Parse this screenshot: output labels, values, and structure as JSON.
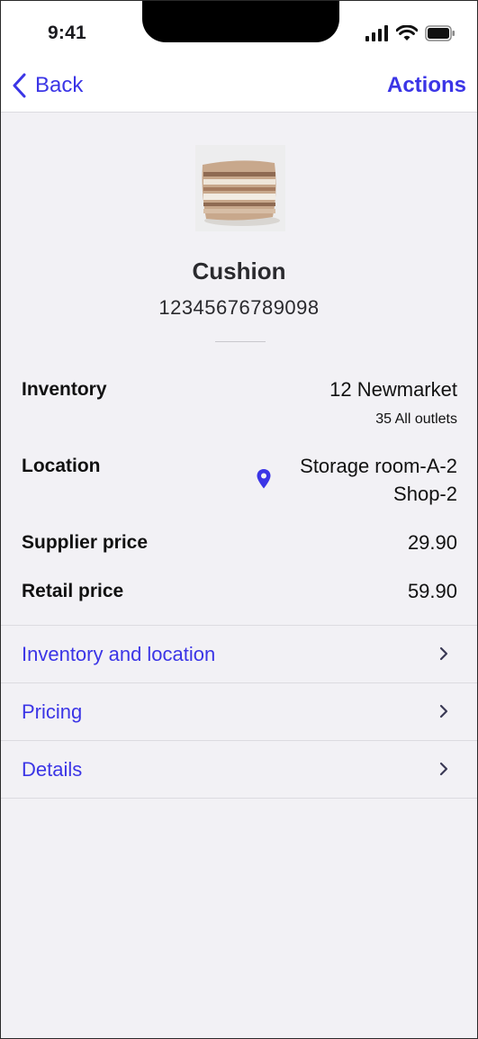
{
  "status_bar": {
    "time": "9:41"
  },
  "nav": {
    "back_label": "Back",
    "actions_label": "Actions"
  },
  "product": {
    "name": "Cushion",
    "code": "12345676789098"
  },
  "info": {
    "inventory_label": "Inventory",
    "inventory_value": "12 Newmarket",
    "inventory_sub": "35 All outlets",
    "location_label": "Location",
    "location_line1": "Storage room-A-2",
    "location_line2": "Shop-2",
    "supplier_price_label": "Supplier price",
    "supplier_price_value": "29.90",
    "retail_price_label": "Retail price",
    "retail_price_value": "59.90"
  },
  "menu": {
    "items": [
      {
        "label": "Inventory and location",
        "icon": "chevron-right-icon"
      },
      {
        "label": "Pricing",
        "icon": "chevron-right-icon"
      },
      {
        "label": "Details",
        "icon": "chevron-right-icon"
      }
    ]
  },
  "colors": {
    "accent": "#3b35e6",
    "background": "#f2f1f5",
    "surface": "#ffffff",
    "divider": "#dcdbe0"
  }
}
